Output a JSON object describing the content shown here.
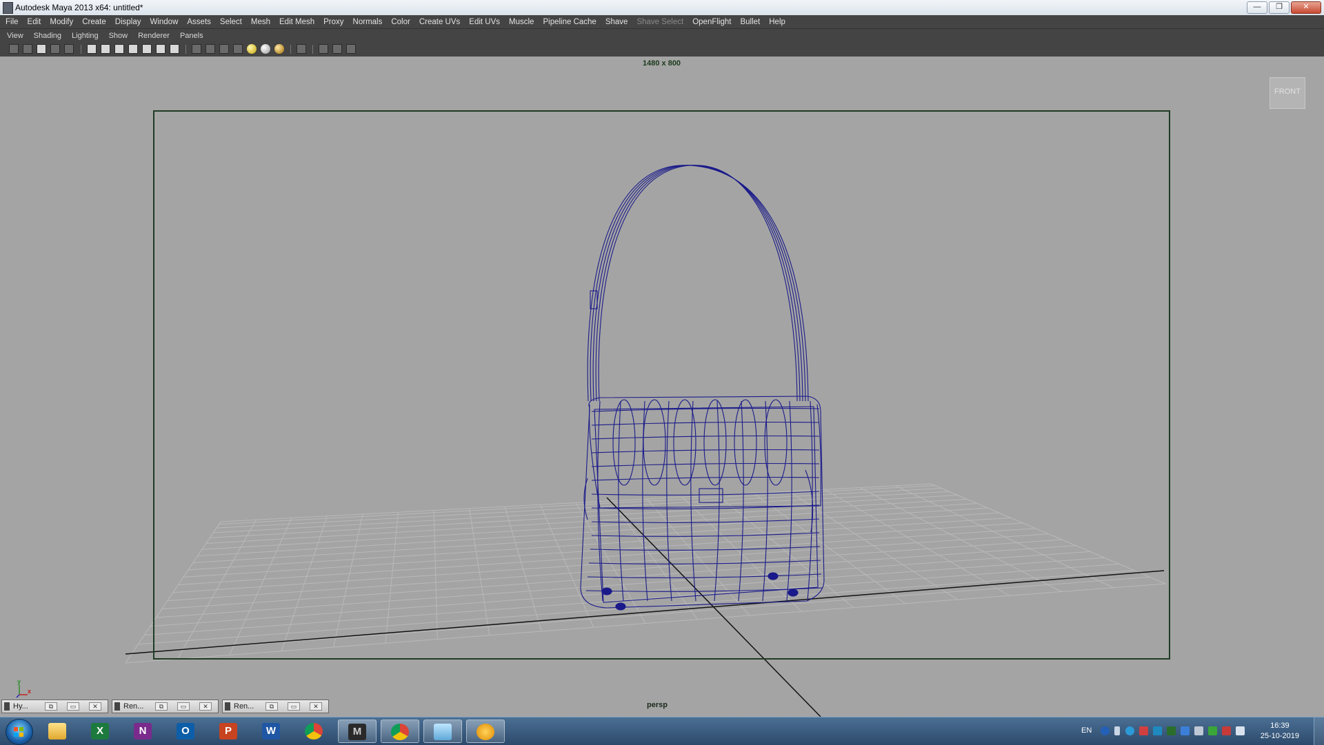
{
  "window": {
    "title": "Autodesk Maya 2013 x64: untitled*",
    "minimize": "—",
    "restore": "❐",
    "close": "✕"
  },
  "main_menu": [
    "File",
    "Edit",
    "Modify",
    "Create",
    "Display",
    "Window",
    "Assets",
    "Select",
    "Mesh",
    "Edit Mesh",
    "Proxy",
    "Normals",
    "Color",
    "Create UVs",
    "Edit UVs",
    "Muscle",
    "Pipeline Cache",
    "Shave",
    "Shave Select",
    "OpenFlight",
    "Bullet",
    "Help"
  ],
  "panel_menu": [
    "View",
    "Shading",
    "Lighting",
    "Show",
    "Renderer",
    "Panels"
  ],
  "viewport": {
    "resolution": "1480 x 800",
    "viewcube_label": "FRONT",
    "camera": "persp",
    "axis_y": "y",
    "axis_x": "x",
    "object": "handbag-wireframe",
    "wire_color": "#1a1a8a",
    "grid_color": "#b9b9b9",
    "background": "#a4a4a4"
  },
  "minimized_windows": [
    {
      "label": "Hy...",
      "btn_restore": "⧉",
      "btn_max": "▭",
      "btn_close": "✕"
    },
    {
      "label": "Ren...",
      "btn_restore": "⧉",
      "btn_max": "▭",
      "btn_close": "✕"
    },
    {
      "label": "Ren...",
      "btn_restore": "⧉",
      "btn_max": "▭",
      "btn_close": "✕"
    }
  ],
  "taskbar": {
    "apps": [
      {
        "name": "Explorer",
        "icon": "folder-icon",
        "glyph": ""
      },
      {
        "name": "Excel",
        "icon": "excel-icon",
        "glyph": "X"
      },
      {
        "name": "OneNote",
        "icon": "onenote-icon",
        "glyph": "N"
      },
      {
        "name": "Outlook",
        "icon": "outlook-icon",
        "glyph": "O"
      },
      {
        "name": "PowerPoint",
        "icon": "powerpoint-icon",
        "glyph": "P"
      },
      {
        "name": "Word",
        "icon": "word-icon",
        "glyph": "W"
      },
      {
        "name": "Chrome",
        "icon": "chrome-icon",
        "glyph": ""
      },
      {
        "name": "Maya",
        "icon": "maya-icon",
        "glyph": "M"
      },
      {
        "name": "Chrome",
        "icon": "chrome-icon",
        "glyph": ""
      },
      {
        "name": "Notepad",
        "icon": "notepad-icon",
        "glyph": ""
      },
      {
        "name": "Paint",
        "icon": "paint-icon",
        "glyph": ""
      }
    ],
    "language": "EN",
    "time": "16:39",
    "date": "25-10-2019"
  }
}
